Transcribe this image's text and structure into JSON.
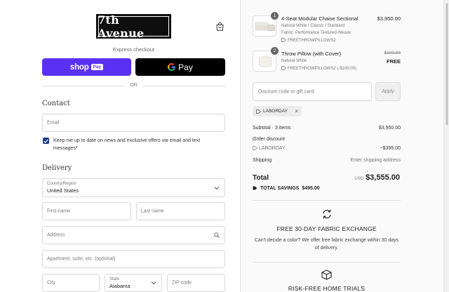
{
  "brand": {
    "logo_text": "7th Avenue"
  },
  "express": {
    "label": "Express checkout",
    "shoppay_label": "shop",
    "shoppay_badge": "Pay",
    "gpay_label": "Pay",
    "or_label": "OR"
  },
  "contact": {
    "heading": "Contact",
    "email_placeholder": "Email",
    "newsletter_text": "Keep me up to date on news and exclusive offers via email and text messages*",
    "newsletter_checked": true
  },
  "delivery": {
    "heading": "Delivery",
    "country_label": "Country/Region",
    "country_value": "United States",
    "first_name_placeholder": "First name",
    "last_name_placeholder": "Last name",
    "address_placeholder": "Address",
    "apartment_placeholder": "Apartment, suite, etc. (optional)",
    "city_placeholder": "City",
    "state_label": "State",
    "state_value": "Alabama",
    "zip_placeholder": "ZIP code"
  },
  "cart": {
    "items": [
      {
        "quantity": "1",
        "name": "4-Seat Modular Chaise Sectional",
        "variant": "Natural White / Classic / Standard",
        "fabric": "Fabric: Performance Textured Weave",
        "discount_tag": "FREETHROWPILLOWS2",
        "price": "$3,950.00"
      },
      {
        "quantity": "2",
        "name": "Throw Pillow (with Cover)",
        "variant": "Natural White",
        "discount_tag": "FREETHROWPILLOWS2 (-$100.00)",
        "original_price": "$100.00",
        "price": "FREE"
      }
    ]
  },
  "discount": {
    "placeholder": "Discount code or gift card",
    "apply_label": "Apply",
    "applied_code": "LABORDAY"
  },
  "summary": {
    "subtotal_label": "Subtotal · 3 items",
    "subtotal_value": "$3,950.00",
    "order_discount_label": "Order discount",
    "discount_code": "LABORDAY",
    "discount_value": "−$395.00",
    "shipping_label": "Shipping",
    "shipping_value": "Enter shipping address",
    "total_label": "Total",
    "currency": "USD",
    "total_value": "$3,555.00",
    "savings_label": "TOTAL SAVINGS",
    "savings_value": "$495.00"
  },
  "perks": [
    {
      "title": "FREE 30-DAY FABRIC EXCHANGE",
      "description": "Can't decide a color? We offer free fabric exchange within 30 days of delivery."
    },
    {
      "title": "RISK-FREE HOME TRIALS",
      "description": ""
    }
  ],
  "colors": {
    "shoppay": "#5a31f4",
    "gpay": "#000000",
    "checkbox": "#1f3a8a"
  }
}
